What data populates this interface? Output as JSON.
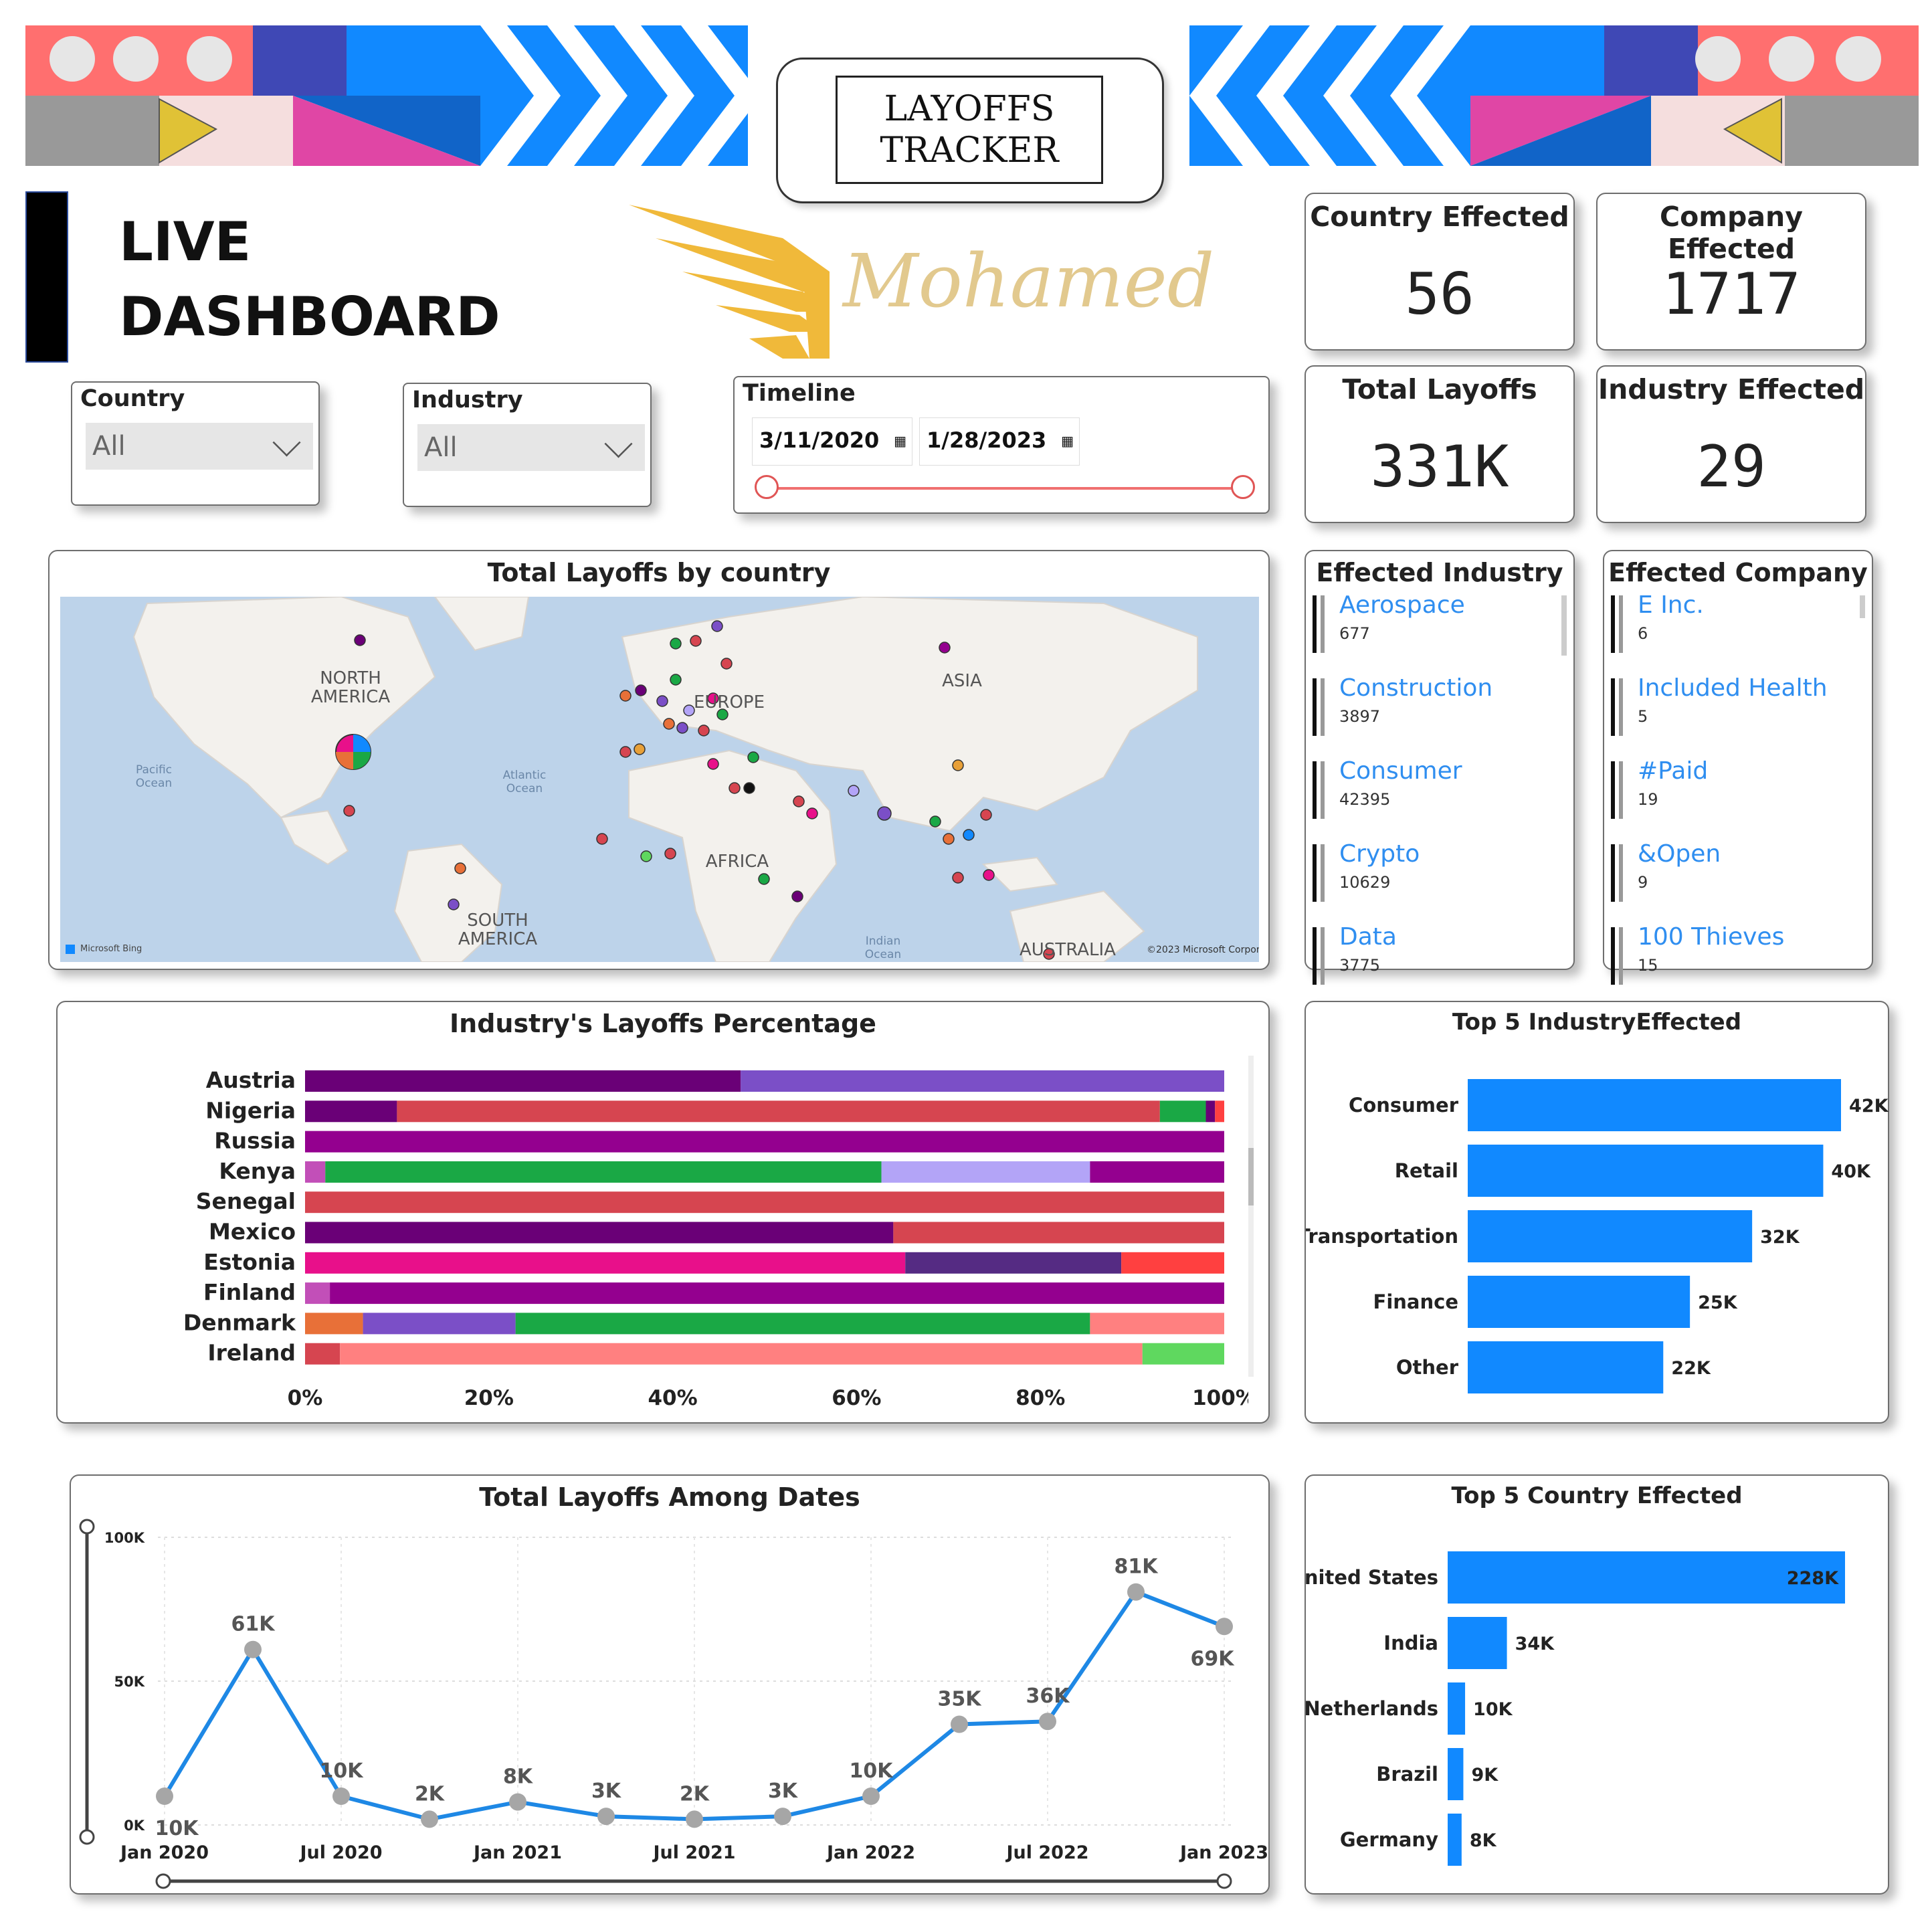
{
  "banner": {
    "title_line1": "LAYOFFS",
    "title_line2": "TRACKER"
  },
  "heading": {
    "line1": "LIVE",
    "line2": "DASHBOARD"
  },
  "logo_text": "Mohamed",
  "filters": {
    "country": {
      "label": "Country",
      "value": "All"
    },
    "industry": {
      "label": "Industry",
      "value": "All"
    },
    "timeline": {
      "label": "Timeline",
      "start": "3/11/2020",
      "end": "1/28/2023"
    }
  },
  "kpis": {
    "country": {
      "title": "Country Effected",
      "value": "56"
    },
    "company": {
      "title": "Company Effected",
      "value": "1717"
    },
    "layoffs": {
      "title": "Total Layoffs",
      "value": "331K"
    },
    "industry": {
      "title": "Industry Effected",
      "value": "29"
    }
  },
  "map": {
    "title": "Total Layoffs by country",
    "labels": [
      "NORTH",
      "AMERICA",
      "EUROPE",
      "ASIA",
      "AFRICA",
      "SOUTH",
      "AMERICA",
      "AUSTRALIA"
    ],
    "oceans": [
      "Pacific",
      "Ocean",
      "Atlantic",
      "Ocean",
      "Indian",
      "Ocean"
    ],
    "credit_left": "Microsoft Bing",
    "credit_right": "©2023 Microsoft Corporation"
  },
  "effected_industry": {
    "title": "Effected Industry",
    "items": [
      {
        "name": "Aerospace",
        "value": "677"
      },
      {
        "name": "Construction",
        "value": "3897"
      },
      {
        "name": "Consumer",
        "value": "42395"
      },
      {
        "name": "Crypto",
        "value": "10629"
      },
      {
        "name": "Data",
        "value": "3775"
      }
    ]
  },
  "effected_company": {
    "title": "Effected Company",
    "items": [
      {
        "name": "E Inc.",
        "value": "6"
      },
      {
        "name": "Included Health",
        "value": "5"
      },
      {
        "name": "#Paid",
        "value": "19"
      },
      {
        "name": "&Open",
        "value": "9"
      },
      {
        "name": "100 Thieves",
        "value": "15"
      }
    ]
  },
  "colors": {
    "accent": "#1189ff",
    "line": "#1e88e5",
    "banner_salmon": "#ff6f6f",
    "banner_blue": "#1189ff",
    "banner_indigo": "#3f48b5",
    "banner_pink": "#e046a5",
    "banner_yellow": "#e0c236",
    "banner_gray": "#999999",
    "logo_gold": "#f0b93a"
  },
  "chart_data": [
    {
      "type": "bar",
      "stacked": "100%",
      "orientation": "horizontal",
      "title": "Industry's Layoffs Percentage",
      "categories": [
        "Austria",
        "Nigeria",
        "Russia",
        "Kenya",
        "Senegal",
        "Mexico",
        "Estonia",
        "Finland",
        "Denmark",
        "Ireland"
      ],
      "segments": [
        [
          {
            "pct": 47.4,
            "color": "#6a0077"
          },
          {
            "pct": 52.6,
            "color": "#7b4fc7"
          }
        ],
        [
          {
            "pct": 10,
            "color": "#6a0077"
          },
          {
            "pct": 83,
            "color": "#d64550"
          },
          {
            "pct": 5,
            "color": "#1aa845"
          },
          {
            "pct": 1,
            "color": "#6a0077"
          },
          {
            "pct": 1,
            "color": "#ff4040"
          }
        ],
        [
          {
            "pct": 100,
            "color": "#94008f"
          }
        ],
        [
          {
            "pct": 2.2,
            "color": "#c24fb8"
          },
          {
            "pct": 60.5,
            "color": "#1aa845"
          },
          {
            "pct": 22.7,
            "color": "#b3a4f7"
          },
          {
            "pct": 14.6,
            "color": "#94008f"
          }
        ],
        [
          {
            "pct": 100,
            "color": "#d64550"
          }
        ],
        [
          {
            "pct": 64,
            "color": "#6a0077"
          },
          {
            "pct": 36,
            "color": "#d64550"
          }
        ],
        [
          {
            "pct": 65.3,
            "color": "#e8108a"
          },
          {
            "pct": 23.5,
            "color": "#552b83"
          },
          {
            "pct": 11.2,
            "color": "#ff4040"
          }
        ],
        [
          {
            "pct": 2.7,
            "color": "#c24fb8"
          },
          {
            "pct": 97.3,
            "color": "#94008f"
          }
        ],
        [
          {
            "pct": 6.3,
            "color": "#e87038"
          },
          {
            "pct": 16.6,
            "color": "#7b4fc7"
          },
          {
            "pct": 62.5,
            "color": "#1aa845"
          },
          {
            "pct": 14.6,
            "color": "#ff8080"
          }
        ],
        [
          {
            "pct": 3.8,
            "color": "#d64550"
          },
          {
            "pct": 87.3,
            "color": "#ff8080"
          },
          {
            "pct": 8.9,
            "color": "#5fd85f"
          }
        ]
      ],
      "x_ticks": [
        "0%",
        "20%",
        "40%",
        "60%",
        "80%",
        "100%"
      ],
      "xlim": [
        0,
        100
      ]
    },
    {
      "type": "bar",
      "orientation": "horizontal",
      "title": "Top 5 IndustryEffected",
      "categories": [
        "Consumer",
        "Retail",
        "Transportation",
        "Finance",
        "Other"
      ],
      "values": [
        42,
        40,
        32,
        25,
        22
      ],
      "labels": [
        "42K",
        "40K",
        "32K",
        "25K",
        "22K"
      ],
      "xlim": [
        0,
        42
      ]
    },
    {
      "type": "line",
      "title": "Total Layoffs Among Dates",
      "x_ticks": [
        "Jan 2020",
        "Jul 2020",
        "Jan 2021",
        "Jul 2021",
        "Jan 2022",
        "Jul 2022",
        "Jan 2023"
      ],
      "y_ticks": [
        "100K",
        "50K",
        "0K"
      ],
      "ylim": [
        0,
        100
      ],
      "x": [
        "Jan 2020",
        "Apr 2020",
        "Jul 2020",
        "Oct 2020",
        "Jan 2021",
        "Apr 2021",
        "Jul 2021",
        "Oct 2021",
        "Jan 2022",
        "Apr 2022",
        "Jul 2022",
        "Oct 2022",
        "Jan 2023"
      ],
      "values": [
        10,
        61,
        10,
        2,
        8,
        3,
        2,
        3,
        10,
        35,
        36,
        81,
        69
      ],
      "labels": [
        "10K",
        "61K",
        "10K",
        "2K",
        "8K",
        "3K",
        "2K",
        "3K",
        "10K",
        "35K",
        "36K",
        "81K",
        "69K"
      ]
    },
    {
      "type": "bar",
      "orientation": "horizontal",
      "title": "Top 5 Country Effected",
      "categories": [
        "United States",
        "India",
        "Netherlands",
        "Brazil",
        "Germany"
      ],
      "values": [
        228,
        34,
        10,
        9,
        8
      ],
      "labels": [
        "228K",
        "34K",
        "10K",
        "9K",
        "8K"
      ],
      "xlim": [
        0,
        228
      ]
    }
  ]
}
